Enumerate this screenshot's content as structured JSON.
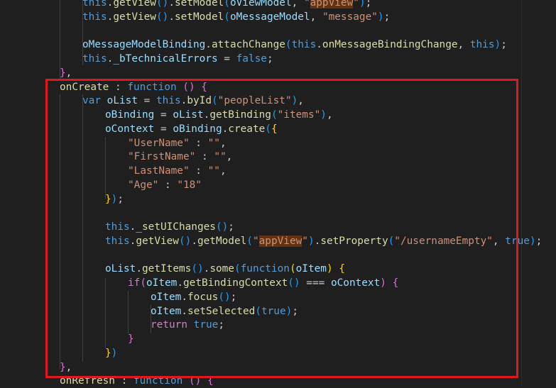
{
  "code_lines": [
    [
      {
        "t": "this",
        "c": "kw"
      },
      {
        "t": ".",
        "c": "punc"
      },
      {
        "t": "getView",
        "c": "fn"
      },
      {
        "t": "()",
        "c": "p3"
      },
      {
        "t": ".",
        "c": "punc"
      },
      {
        "t": "setModel",
        "c": "fn"
      },
      {
        "t": "(",
        "c": "p3"
      },
      {
        "t": "oViewModel",
        "c": "var"
      },
      {
        "t": ", ",
        "c": "punc"
      },
      {
        "t": "\"",
        "c": "str"
      },
      {
        "t": "appView",
        "c": "str str-hl"
      },
      {
        "t": "\"",
        "c": "str"
      },
      {
        "t": ")",
        "c": "p3"
      },
      {
        "t": ";",
        "c": "punc"
      }
    ],
    [
      {
        "t": "this",
        "c": "kw"
      },
      {
        "t": ".",
        "c": "punc"
      },
      {
        "t": "getView",
        "c": "fn"
      },
      {
        "t": "()",
        "c": "p3"
      },
      {
        "t": ".",
        "c": "punc"
      },
      {
        "t": "setModel",
        "c": "fn"
      },
      {
        "t": "(",
        "c": "p3"
      },
      {
        "t": "oMessageModel",
        "c": "var"
      },
      {
        "t": ", ",
        "c": "punc"
      },
      {
        "t": "\"message\"",
        "c": "str"
      },
      {
        "t": ")",
        "c": "p3"
      },
      {
        "t": ";",
        "c": "punc"
      }
    ],
    [],
    [
      {
        "t": "oMessageModelBinding",
        "c": "var"
      },
      {
        "t": ".",
        "c": "punc"
      },
      {
        "t": "attachChange",
        "c": "fn"
      },
      {
        "t": "(",
        "c": "p3"
      },
      {
        "t": "this",
        "c": "kw"
      },
      {
        "t": ".",
        "c": "punc"
      },
      {
        "t": "onMessageBindingChange",
        "c": "fn"
      },
      {
        "t": ", ",
        "c": "punc"
      },
      {
        "t": "this",
        "c": "kw"
      },
      {
        "t": ")",
        "c": "p3"
      },
      {
        "t": ";",
        "c": "punc"
      }
    ],
    [
      {
        "t": "this",
        "c": "kw"
      },
      {
        "t": ".",
        "c": "punc"
      },
      {
        "t": "_bTechnicalErrors",
        "c": "var"
      },
      {
        "t": " = ",
        "c": "punc"
      },
      {
        "t": "false",
        "c": "kw"
      },
      {
        "t": ";",
        "c": "punc"
      }
    ],
    [
      {
        "t": "}",
        "c": "p2"
      },
      {
        "t": ",",
        "c": "punc"
      }
    ],
    [
      {
        "t": "onCreate",
        "c": "fn"
      },
      {
        "t": " : ",
        "c": "punc"
      },
      {
        "t": "function",
        "c": "kw"
      },
      {
        "t": " ",
        "c": "punc"
      },
      {
        "t": "()",
        "c": "p2"
      },
      {
        "t": " ",
        "c": "punc"
      },
      {
        "t": "{",
        "c": "p2"
      }
    ],
    [
      {
        "t": "var",
        "c": "kw"
      },
      {
        "t": " ",
        "c": "punc"
      },
      {
        "t": "oList",
        "c": "var"
      },
      {
        "t": " = ",
        "c": "punc"
      },
      {
        "t": "this",
        "c": "kw"
      },
      {
        "t": ".",
        "c": "punc"
      },
      {
        "t": "byId",
        "c": "fn"
      },
      {
        "t": "(",
        "c": "p3"
      },
      {
        "t": "\"peopleList\"",
        "c": "str"
      },
      {
        "t": ")",
        "c": "p3"
      },
      {
        "t": ",",
        "c": "punc"
      }
    ],
    [
      {
        "t": "oBinding",
        "c": "var"
      },
      {
        "t": " = ",
        "c": "punc"
      },
      {
        "t": "oList",
        "c": "var"
      },
      {
        "t": ".",
        "c": "punc"
      },
      {
        "t": "getBinding",
        "c": "fn"
      },
      {
        "t": "(",
        "c": "p3"
      },
      {
        "t": "\"items\"",
        "c": "str"
      },
      {
        "t": ")",
        "c": "p3"
      },
      {
        "t": ",",
        "c": "punc"
      }
    ],
    [
      {
        "t": "oContext",
        "c": "var"
      },
      {
        "t": " = ",
        "c": "punc"
      },
      {
        "t": "oBinding",
        "c": "var"
      },
      {
        "t": ".",
        "c": "punc"
      },
      {
        "t": "create",
        "c": "fn"
      },
      {
        "t": "(",
        "c": "p3"
      },
      {
        "t": "{",
        "c": "p1"
      }
    ],
    [
      {
        "t": "\"UserName\"",
        "c": "str"
      },
      {
        "t": " : ",
        "c": "punc"
      },
      {
        "t": "\"\"",
        "c": "str"
      },
      {
        "t": ",",
        "c": "punc"
      }
    ],
    [
      {
        "t": "\"FirstName\"",
        "c": "str"
      },
      {
        "t": " : ",
        "c": "punc"
      },
      {
        "t": "\"\"",
        "c": "str"
      },
      {
        "t": ",",
        "c": "punc"
      }
    ],
    [
      {
        "t": "\"LastName\"",
        "c": "str"
      },
      {
        "t": " : ",
        "c": "punc"
      },
      {
        "t": "\"\"",
        "c": "str"
      },
      {
        "t": ",",
        "c": "punc"
      }
    ],
    [
      {
        "t": "\"Age\"",
        "c": "str"
      },
      {
        "t": " : ",
        "c": "punc"
      },
      {
        "t": "\"18\"",
        "c": "str"
      }
    ],
    [
      {
        "t": "}",
        "c": "p1"
      },
      {
        "t": ")",
        "c": "p3"
      },
      {
        "t": ";",
        "c": "punc"
      }
    ],
    [],
    [
      {
        "t": "this",
        "c": "kw"
      },
      {
        "t": ".",
        "c": "punc"
      },
      {
        "t": "_setUIChanges",
        "c": "fn"
      },
      {
        "t": "()",
        "c": "p3"
      },
      {
        "t": ";",
        "c": "punc"
      }
    ],
    [
      {
        "t": "this",
        "c": "kw"
      },
      {
        "t": ".",
        "c": "punc"
      },
      {
        "t": "getView",
        "c": "fn"
      },
      {
        "t": "()",
        "c": "p3"
      },
      {
        "t": ".",
        "c": "punc"
      },
      {
        "t": "getModel",
        "c": "fn"
      },
      {
        "t": "(",
        "c": "p3"
      },
      {
        "t": "\"",
        "c": "str"
      },
      {
        "t": "appView",
        "c": "str str-hl"
      },
      {
        "t": "\"",
        "c": "str"
      },
      {
        "t": ")",
        "c": "p3"
      },
      {
        "t": ".",
        "c": "punc"
      },
      {
        "t": "setProperty",
        "c": "fn"
      },
      {
        "t": "(",
        "c": "p3"
      },
      {
        "t": "\"/usernameEmpty\"",
        "c": "str"
      },
      {
        "t": ", ",
        "c": "punc"
      },
      {
        "t": "true",
        "c": "kw"
      },
      {
        "t": ")",
        "c": "p3"
      },
      {
        "t": ";",
        "c": "punc"
      }
    ],
    [],
    [
      {
        "t": "oList",
        "c": "var"
      },
      {
        "t": ".",
        "c": "punc"
      },
      {
        "t": "getItems",
        "c": "fn"
      },
      {
        "t": "()",
        "c": "p3"
      },
      {
        "t": ".",
        "c": "punc"
      },
      {
        "t": "some",
        "c": "fn"
      },
      {
        "t": "(",
        "c": "p3"
      },
      {
        "t": "function",
        "c": "kw"
      },
      {
        "t": "(",
        "c": "p1"
      },
      {
        "t": "oItem",
        "c": "var"
      },
      {
        "t": ")",
        "c": "p1"
      },
      {
        "t": " ",
        "c": "punc"
      },
      {
        "t": "{",
        "c": "p1"
      }
    ],
    [
      {
        "t": "if",
        "c": "ctl"
      },
      {
        "t": "(",
        "c": "p2"
      },
      {
        "t": "oItem",
        "c": "var"
      },
      {
        "t": ".",
        "c": "punc"
      },
      {
        "t": "getBindingContext",
        "c": "fn"
      },
      {
        "t": "()",
        "c": "p3"
      },
      {
        "t": " === ",
        "c": "punc"
      },
      {
        "t": "oContext",
        "c": "var"
      },
      {
        "t": ")",
        "c": "p2"
      },
      {
        "t": " ",
        "c": "punc"
      },
      {
        "t": "{",
        "c": "p2"
      }
    ],
    [
      {
        "t": "oItem",
        "c": "var"
      },
      {
        "t": ".",
        "c": "punc"
      },
      {
        "t": "focus",
        "c": "fn"
      },
      {
        "t": "()",
        "c": "p3"
      },
      {
        "t": ";",
        "c": "punc"
      }
    ],
    [
      {
        "t": "oItem",
        "c": "var"
      },
      {
        "t": ".",
        "c": "punc"
      },
      {
        "t": "setSelected",
        "c": "fn"
      },
      {
        "t": "(",
        "c": "p3"
      },
      {
        "t": "true",
        "c": "kw"
      },
      {
        "t": ")",
        "c": "p3"
      },
      {
        "t": ";",
        "c": "punc"
      }
    ],
    [
      {
        "t": "return",
        "c": "ctl"
      },
      {
        "t": " ",
        "c": "punc"
      },
      {
        "t": "true",
        "c": "kw"
      },
      {
        "t": ";",
        "c": "punc"
      }
    ],
    [
      {
        "t": "}",
        "c": "p2"
      }
    ],
    [
      {
        "t": "}",
        "c": "p1"
      },
      {
        "t": ")",
        "c": "p3"
      }
    ],
    [
      {
        "t": "}",
        "c": "p2"
      },
      {
        "t": ",",
        "c": "punc"
      }
    ],
    [
      {
        "t": "onRefresh",
        "c": "fn"
      },
      {
        "t": " : ",
        "c": "punc"
      },
      {
        "t": "function",
        "c": "kw"
      },
      {
        "t": " ",
        "c": "punc"
      },
      {
        "t": "()",
        "c": "p2"
      },
      {
        "t": " ",
        "c": "punc"
      },
      {
        "t": "{",
        "c": "p2"
      }
    ]
  ]
}
